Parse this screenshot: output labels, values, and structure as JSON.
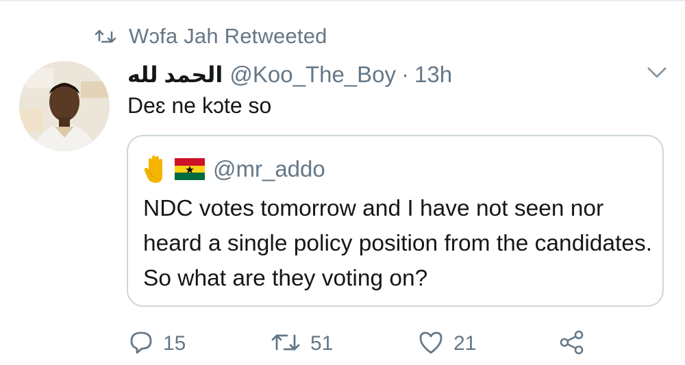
{
  "retweet_context": {
    "icon": "retweet-icon",
    "text": "Wɔfa Jah Retweeted"
  },
  "tweet": {
    "avatar_icon": "user-avatar",
    "display_name": "الحمد لله",
    "handle": "@Koo_The_Boy",
    "separator": "·",
    "time": "13h",
    "text": "Deɛ ne kɔte so",
    "menu_icon": "chevron-down-icon"
  },
  "quote": {
    "hand_icon": "raised-hand-emoji",
    "flag_icon": "ghana-flag-emoji",
    "handle": "@mr_addo",
    "text": "NDC votes tomorrow and I have not seen nor heard a single policy position from the candidates. So what are they voting on?"
  },
  "actions": {
    "reply_count": "15",
    "retweet_count": "51",
    "like_count": "21",
    "icons": [
      "reply-icon",
      "retweet-icon",
      "like-icon",
      "share-icon"
    ]
  },
  "colors": {
    "text_primary": "#14171a",
    "text_secondary": "#657786",
    "border": "#ccd6dd"
  }
}
